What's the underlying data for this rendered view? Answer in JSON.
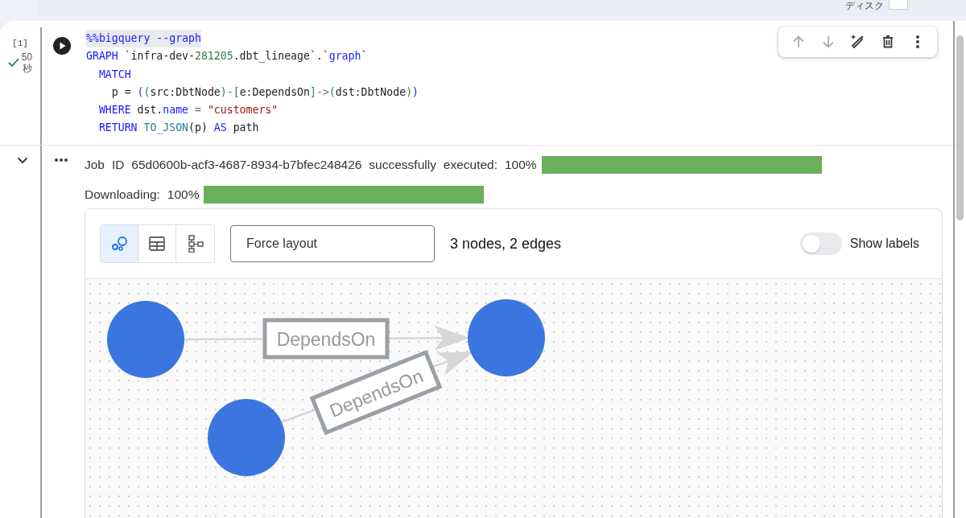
{
  "top_bar": {
    "disk_label": "ディスク"
  },
  "cell": {
    "execution_count": "[1]",
    "succeeded": true,
    "duration": "50 秒",
    "code_lines": [
      [
        {
          "kind": "magic",
          "text": "%%bigquery --graph"
        }
      ],
      [
        {
          "kind": "keyword",
          "text": "GRAPH"
        },
        {
          "kind": "plain",
          "text": " `infra-dev-"
        },
        {
          "kind": "number",
          "text": "281205"
        },
        {
          "kind": "plain",
          "text": ".dbt_lineage`.`"
        },
        {
          "kind": "keyword",
          "text": "graph"
        },
        {
          "kind": "plain",
          "text": "`"
        }
      ],
      [
        {
          "kind": "keyword",
          "text": "  MATCH"
        }
      ],
      [
        {
          "kind": "plain",
          "text": "    p = "
        },
        {
          "kind": "keyword",
          "text": "("
        },
        {
          "kind": "number",
          "text": "("
        },
        {
          "kind": "plain",
          "text": "src:DbtNode"
        },
        {
          "kind": "number",
          "text": ")"
        },
        {
          "kind": "operator",
          "text": "-"
        },
        {
          "kind": "number",
          "text": "["
        },
        {
          "kind": "plain",
          "text": "e:DependsOn"
        },
        {
          "kind": "number",
          "text": "]"
        },
        {
          "kind": "operator",
          "text": "->"
        },
        {
          "kind": "number",
          "text": "("
        },
        {
          "kind": "plain",
          "text": "dst:DbtNode"
        },
        {
          "kind": "number",
          "text": ")"
        },
        {
          "kind": "keyword",
          "text": ")"
        }
      ],
      [
        {
          "kind": "keyword",
          "text": "  WHERE"
        },
        {
          "kind": "plain",
          "text": " dst."
        },
        {
          "kind": "keyword",
          "text": "name"
        },
        {
          "kind": "operator",
          "text": " = "
        },
        {
          "kind": "string",
          "text": "\"customers\""
        }
      ],
      [
        {
          "kind": "keyword",
          "text": "  RETURN"
        },
        {
          "kind": "function",
          "text": " TO_JSON"
        },
        {
          "kind": "plain",
          "text": "(p) "
        },
        {
          "kind": "keyword",
          "text": "AS"
        },
        {
          "kind": "plain",
          "text": " path"
        }
      ]
    ],
    "toolbar": [
      {
        "kind": "up",
        "disabled": true
      },
      {
        "kind": "down",
        "disabled": true
      },
      {
        "kind": "magic",
        "disabled": false
      },
      {
        "kind": "delete",
        "disabled": false
      },
      {
        "kind": "more",
        "disabled": false
      }
    ]
  },
  "output": {
    "job_text": "Job ID 65d0600b-acf3-4687-8934-b7bfec248426 successfully executed: 100%",
    "job_progress": {
      "level": 1
    },
    "download_text": "Downloading: 100%",
    "download_progress": {
      "level": 1
    },
    "graph_widget": {
      "views": [
        {
          "kind": "graph",
          "selected": true
        },
        {
          "kind": "table",
          "selected": false
        },
        {
          "kind": "hierarchy",
          "selected": false
        }
      ],
      "layout": {
        "value": "Force layout"
      },
      "summary": "3 nodes, 2 edges",
      "show_labels": {
        "label": "Show labels",
        "on": false
      },
      "edges": [
        {
          "label": "DependsOn"
        },
        {
          "label": "DependsOn"
        }
      ]
    }
  }
}
